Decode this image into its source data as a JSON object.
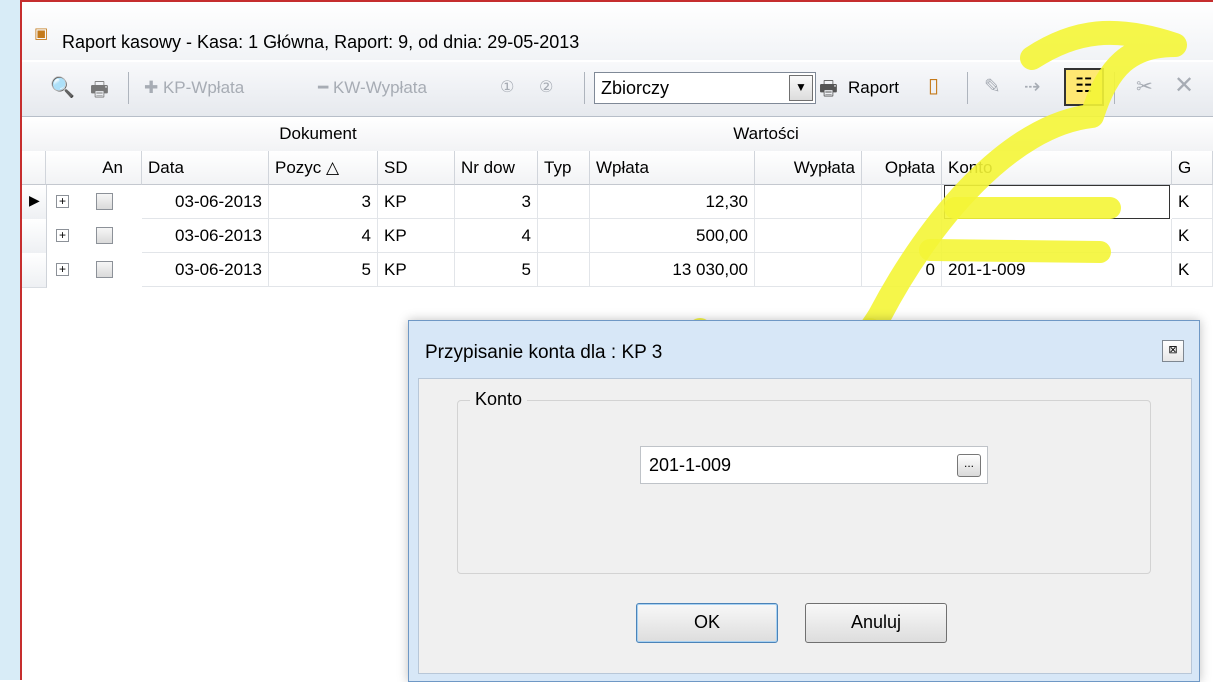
{
  "window": {
    "title": "Raport kasowy - Kasa: 1  Główna,  Raport: 9, od dnia: 29-05-2013"
  },
  "toolbar": {
    "kp_label": "KP-Wpłata",
    "kw_label": "KW-Wypłata",
    "circle_1": "1",
    "circle_2": "2",
    "combo_value": "Zbiorczy",
    "report_label": "Raport"
  },
  "grid": {
    "groups": [
      "Dokument",
      "Wartości"
    ],
    "columns": [
      "An",
      "Data",
      "Pozyc",
      "SD",
      "Nr dow",
      "Typ",
      "Wpłata",
      "Wypłata",
      "Opłata",
      "Konto",
      "G"
    ],
    "rows": [
      {
        "date": "03-06-2013",
        "position": "3",
        "sd": "KP",
        "doc_no": "3",
        "type": "",
        "income": "12,30",
        "payout": "",
        "fee": "",
        "account": "",
        "g": "K"
      },
      {
        "date": "03-06-2013",
        "position": "4",
        "sd": "KP",
        "doc_no": "4",
        "type": "",
        "income": "500,00",
        "payout": "",
        "fee": "",
        "account": "",
        "g": "K"
      },
      {
        "date": "03-06-2013",
        "position": "5",
        "sd": "KP",
        "doc_no": "5",
        "type": "",
        "income": "13 030,00",
        "payout": "",
        "fee": "0",
        "account": "201-1-009",
        "g": "K"
      }
    ]
  },
  "dialog": {
    "title": "Przypisanie konta dla :  KP 3",
    "group_label": "Konto",
    "konto_value": "201-1-009",
    "ok_label": "OK",
    "cancel_label": "Anuluj"
  },
  "colors": {
    "accent": "#f4f536",
    "frame": "#c62e2e"
  }
}
